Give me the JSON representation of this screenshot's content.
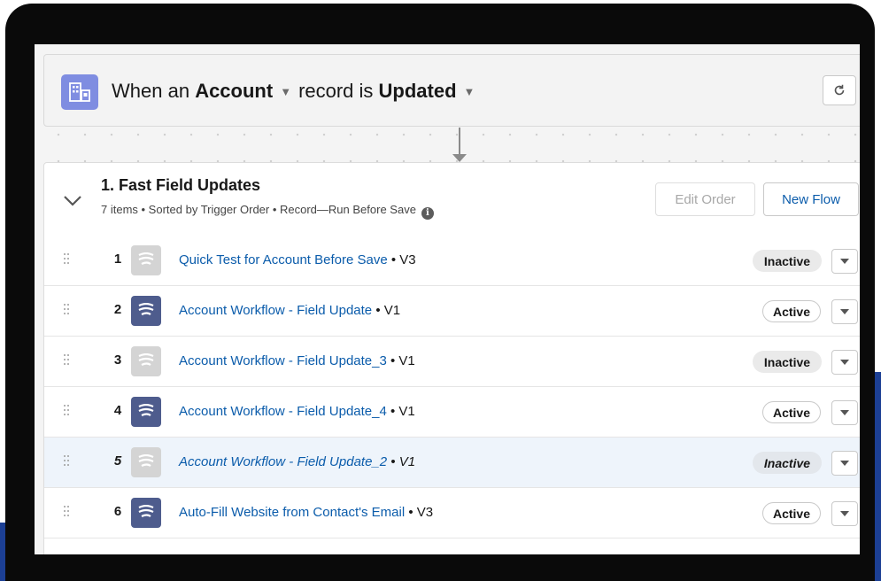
{
  "trigger": {
    "prefix": "When an",
    "object": "Account",
    "middle": "record is",
    "event": "Updated",
    "refresh_icon": "refresh-icon"
  },
  "section": {
    "title": "1. Fast Field Updates",
    "subtitle": "7 items • Sorted by Trigger Order • Record—Run Before Save",
    "edit_order_label": "Edit Order",
    "new_flow_label": "New Flow"
  },
  "rows": [
    {
      "num": "1",
      "name": "Quick Test for Account Before Save",
      "version": " • V3",
      "status": "Inactive"
    },
    {
      "num": "2",
      "name": "Account Workflow - Field Update",
      "version": " • V1",
      "status": "Active"
    },
    {
      "num": "3",
      "name": "Account Workflow - Field Update_3",
      "version": " • V1",
      "status": "Inactive"
    },
    {
      "num": "4",
      "name": "Account Workflow - Field Update_4",
      "version": " • V1",
      "status": "Active"
    },
    {
      "num": "5",
      "name": "Account Workflow - Field Update_2",
      "version": " • V1",
      "status": "Inactive"
    },
    {
      "num": "6",
      "name": "Auto-Fill Website from Contact's Email",
      "version": " • V3",
      "status": "Active"
    }
  ],
  "colors": {
    "trigger_icon": "#7f8de1",
    "active_flow_icon": "#4e5c8d",
    "inactive_flow_icon": "#d4d4d4",
    "link": "#0b5cab",
    "selected_row": "#eef4fb"
  }
}
